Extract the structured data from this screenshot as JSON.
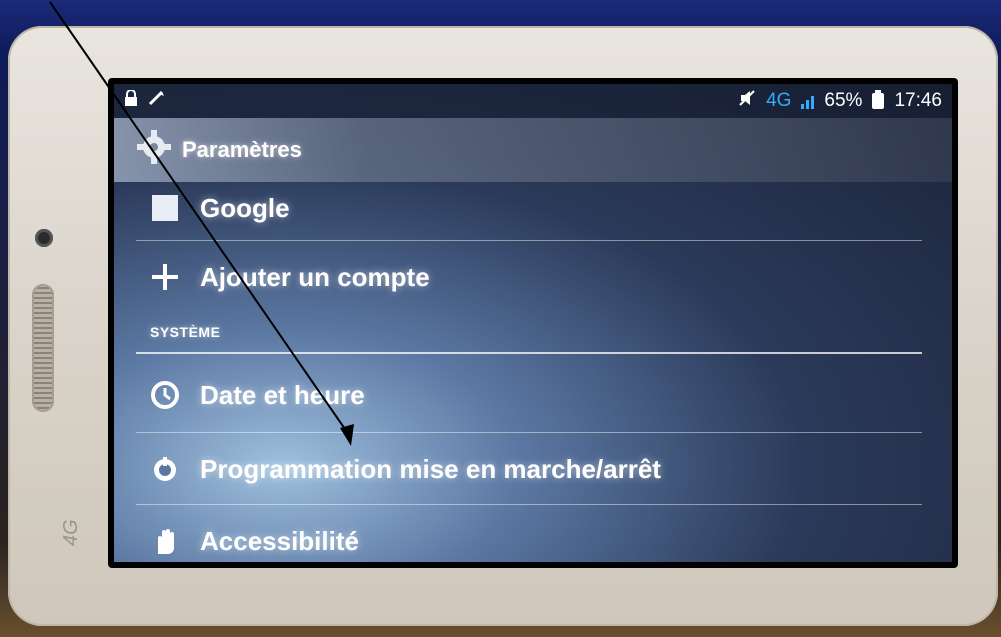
{
  "statusbar": {
    "network": "4G",
    "battery": "65%",
    "time": "17:46"
  },
  "actionbar": {
    "title": "Paramètres"
  },
  "accounts": {
    "google_label": "Google",
    "add_account_label": "Ajouter un compte"
  },
  "system": {
    "header": "SYSTÈME",
    "items": [
      {
        "label": "Date et heure",
        "icon": "clock-icon"
      },
      {
        "label": "Programmation mise en marche/arrêt",
        "icon": "power-schedule-icon"
      },
      {
        "label": "Accessibilité",
        "icon": "hand-icon"
      }
    ]
  },
  "hardware": {
    "brand_label": "4G"
  },
  "colors": {
    "accent_4g": "#33a9ff",
    "text": "#ffffff"
  }
}
